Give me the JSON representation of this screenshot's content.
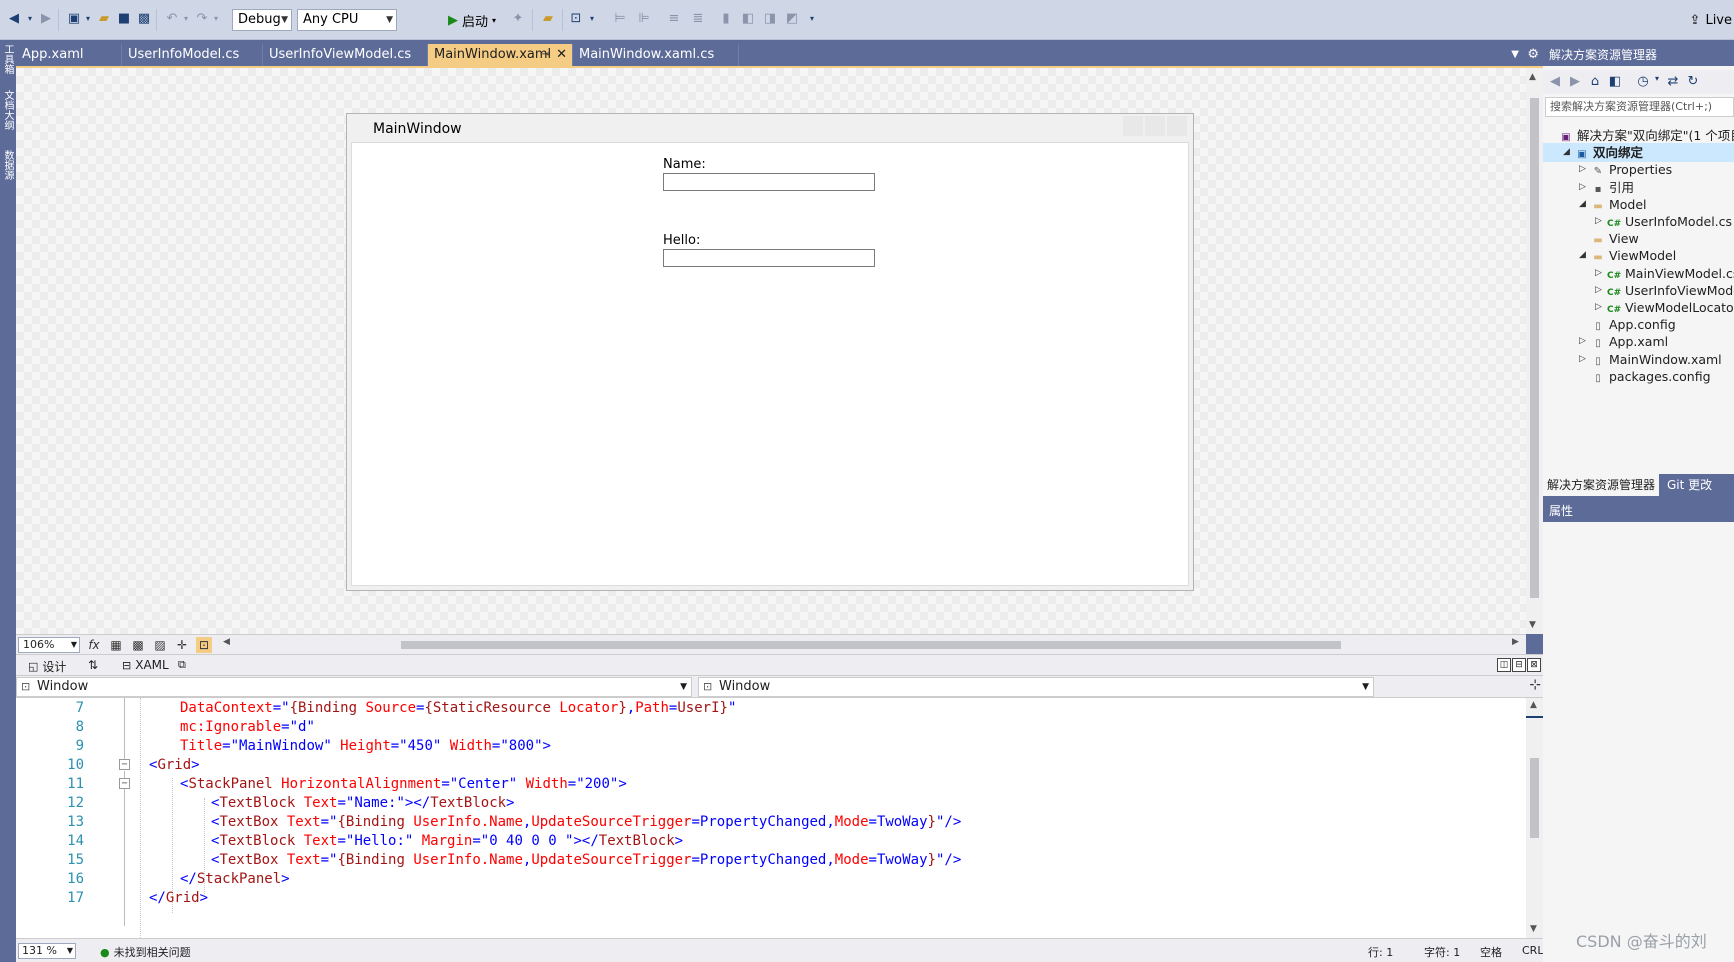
{
  "toolbar": {
    "config_combo": "Debug",
    "platform_combo": "Any CPU",
    "start_label": "启动",
    "live_share_label": "Live"
  },
  "left_rail": {
    "items": [
      "工具箱",
      "文档大纲",
      "数据源"
    ]
  },
  "doc_tabs": [
    {
      "label": "App.xaml",
      "active": false
    },
    {
      "label": "UserInfoModel.cs",
      "active": false
    },
    {
      "label": "UserInfoViewModel.cs",
      "active": false
    },
    {
      "label": "MainWindow.xaml",
      "active": true
    },
    {
      "label": "MainWindow.xaml.cs",
      "active": false
    }
  ],
  "designer": {
    "window_title": "MainWindow",
    "name_label": "Name:",
    "hello_label": "Hello:",
    "zoom": "106%",
    "formula_icon": "fx"
  },
  "split_bar": {
    "design_tab": "设计",
    "swap_icon": "⇅",
    "xaml_tab": "XAML"
  },
  "nav": {
    "left_element": "Window",
    "right_element": "Window"
  },
  "code": {
    "lines": [
      {
        "num": "7",
        "tokens": [
          {
            "t": "DataContext",
            "c": "x-attr"
          },
          {
            "t": "=\"",
            "c": "x-punc"
          },
          {
            "t": "{Binding ",
            "c": "x-tag"
          },
          {
            "t": "Source",
            "c": "x-attr"
          },
          {
            "t": "=",
            "c": "x-punc"
          },
          {
            "t": "{StaticResource ",
            "c": "x-tag"
          },
          {
            "t": "Locator",
            "c": "x-attr"
          },
          {
            "t": "}",
            "c": "x-tag"
          },
          {
            "t": ",",
            "c": "x-punc"
          },
          {
            "t": "Path",
            "c": "x-attr"
          },
          {
            "t": "=",
            "c": "x-punc"
          },
          {
            "t": "UserI}",
            "c": "x-tag"
          },
          {
            "t": "\"",
            "c": "x-punc"
          }
        ]
      },
      {
        "num": "8",
        "tokens": [
          {
            "t": "mc:Ignorable",
            "c": "x-attr"
          },
          {
            "t": "=\"",
            "c": "x-punc"
          },
          {
            "t": "d",
            "c": "x-val"
          },
          {
            "t": "\"",
            "c": "x-punc"
          }
        ]
      },
      {
        "num": "9",
        "tokens": [
          {
            "t": "Title",
            "c": "x-attr"
          },
          {
            "t": "=\"",
            "c": "x-punc"
          },
          {
            "t": "MainWindow",
            "c": "x-val"
          },
          {
            "t": "\" ",
            "c": "x-punc"
          },
          {
            "t": "Height",
            "c": "x-attr"
          },
          {
            "t": "=\"",
            "c": "x-punc"
          },
          {
            "t": "450",
            "c": "x-val"
          },
          {
            "t": "\" ",
            "c": "x-punc"
          },
          {
            "t": "Width",
            "c": "x-attr"
          },
          {
            "t": "=\"",
            "c": "x-punc"
          },
          {
            "t": "800",
            "c": "x-val"
          },
          {
            "t": "\">",
            "c": "x-punc"
          }
        ]
      },
      {
        "num": "10",
        "tokens": [
          {
            "t": "<",
            "c": "x-punc"
          },
          {
            "t": "Grid",
            "c": "x-tag"
          },
          {
            "t": ">",
            "c": "x-punc"
          }
        ]
      },
      {
        "num": "11",
        "tokens": [
          {
            "t": "<",
            "c": "x-punc"
          },
          {
            "t": "StackPanel ",
            "c": "x-tag"
          },
          {
            "t": "HorizontalAlignment",
            "c": "x-attr"
          },
          {
            "t": "=\"",
            "c": "x-punc"
          },
          {
            "t": "Center",
            "c": "x-val"
          },
          {
            "t": "\" ",
            "c": "x-punc"
          },
          {
            "t": "Width",
            "c": "x-attr"
          },
          {
            "t": "=\"",
            "c": "x-punc"
          },
          {
            "t": "200",
            "c": "x-val"
          },
          {
            "t": "\">",
            "c": "x-punc"
          }
        ]
      },
      {
        "num": "12",
        "tokens": [
          {
            "t": "<",
            "c": "x-punc"
          },
          {
            "t": "TextBlock ",
            "c": "x-tag"
          },
          {
            "t": "Text",
            "c": "x-attr"
          },
          {
            "t": "=\"",
            "c": "x-punc"
          },
          {
            "t": "Name:",
            "c": "x-val"
          },
          {
            "t": "\"></",
            "c": "x-punc"
          },
          {
            "t": "TextBlock",
            "c": "x-tag"
          },
          {
            "t": ">",
            "c": "x-punc"
          }
        ]
      },
      {
        "num": "13",
        "tokens": [
          {
            "t": "<",
            "c": "x-punc"
          },
          {
            "t": "TextBox ",
            "c": "x-tag"
          },
          {
            "t": "Text",
            "c": "x-attr"
          },
          {
            "t": "=\"",
            "c": "x-punc"
          },
          {
            "t": "{Binding ",
            "c": "x-tag"
          },
          {
            "t": "UserInfo.Name",
            "c": "x-attr"
          },
          {
            "t": ",",
            "c": "x-punc"
          },
          {
            "t": "UpdateSourceTrigger",
            "c": "x-attr"
          },
          {
            "t": "=",
            "c": "x-punc"
          },
          {
            "t": "PropertyChanged",
            "c": "x-val"
          },
          {
            "t": ",",
            "c": "x-punc"
          },
          {
            "t": "Mode",
            "c": "x-attr"
          },
          {
            "t": "=",
            "c": "x-punc"
          },
          {
            "t": "TwoWay",
            "c": "x-val"
          },
          {
            "t": "}",
            "c": "x-tag"
          },
          {
            "t": "\"/>",
            "c": "x-punc"
          }
        ]
      },
      {
        "num": "14",
        "tokens": [
          {
            "t": "<",
            "c": "x-punc"
          },
          {
            "t": "TextBlock ",
            "c": "x-tag"
          },
          {
            "t": "Text",
            "c": "x-attr"
          },
          {
            "t": "=\"",
            "c": "x-punc"
          },
          {
            "t": "Hello:",
            "c": "x-val"
          },
          {
            "t": "\" ",
            "c": "x-punc"
          },
          {
            "t": "Margin",
            "c": "x-attr"
          },
          {
            "t": "=\"",
            "c": "x-punc"
          },
          {
            "t": "0 40 0 0 ",
            "c": "x-val"
          },
          {
            "t": "\"></",
            "c": "x-punc"
          },
          {
            "t": "TextBlock",
            "c": "x-tag"
          },
          {
            "t": ">",
            "c": "x-punc"
          }
        ]
      },
      {
        "num": "15",
        "tokens": [
          {
            "t": "<",
            "c": "x-punc"
          },
          {
            "t": "TextBox ",
            "c": "x-tag"
          },
          {
            "t": "Text",
            "c": "x-attr"
          },
          {
            "t": "=\"",
            "c": "x-punc"
          },
          {
            "t": "{Binding ",
            "c": "x-tag"
          },
          {
            "t": "UserInfo.Name",
            "c": "x-attr"
          },
          {
            "t": ",",
            "c": "x-punc"
          },
          {
            "t": "UpdateSourceTrigger",
            "c": "x-attr"
          },
          {
            "t": "=",
            "c": "x-punc"
          },
          {
            "t": "PropertyChanged",
            "c": "x-val"
          },
          {
            "t": ",",
            "c": "x-punc"
          },
          {
            "t": "Mode",
            "c": "x-attr"
          },
          {
            "t": "=",
            "c": "x-punc"
          },
          {
            "t": "TwoWay",
            "c": "x-val"
          },
          {
            "t": "}",
            "c": "x-tag"
          },
          {
            "t": "\"/>",
            "c": "x-punc"
          }
        ]
      },
      {
        "num": "16",
        "tokens": [
          {
            "t": "</",
            "c": "x-punc"
          },
          {
            "t": "StackPanel",
            "c": "x-tag"
          },
          {
            "t": ">",
            "c": "x-punc"
          }
        ]
      },
      {
        "num": "17",
        "tokens": [
          {
            "t": "</",
            "c": "x-punc"
          },
          {
            "t": "Grid",
            "c": "x-tag"
          },
          {
            "t": ">",
            "c": "x-punc"
          }
        ]
      }
    ]
  },
  "status": {
    "zoom": "131 %",
    "issues": "未找到相关问题",
    "line": "行: 1",
    "char": "字符: 1",
    "space": "空格",
    "eol": "CRLF"
  },
  "solution_explorer": {
    "title": "解决方案资源管理器",
    "search_placeholder": "搜索解决方案资源管理器(Ctrl+;)",
    "tree": [
      {
        "label": "解决方案\"双向绑定\"(1 个项目",
        "icon": "sln",
        "arrow": ""
      },
      {
        "label": "双向绑定",
        "icon": "proj",
        "arrow": "◢"
      },
      {
        "label": "Properties",
        "icon": "wrench",
        "arrow": "▷"
      },
      {
        "label": "引用",
        "icon": "ref",
        "arrow": "▷"
      },
      {
        "label": "Model",
        "icon": "folder",
        "arrow": "◢"
      },
      {
        "label": "UserInfoModel.cs",
        "icon": "cs",
        "arrow": "▷"
      },
      {
        "label": "View",
        "icon": "folder",
        "arrow": ""
      },
      {
        "label": "ViewModel",
        "icon": "folder",
        "arrow": "◢"
      },
      {
        "label": "MainViewModel.cs",
        "icon": "cs",
        "arrow": "▷"
      },
      {
        "label": "UserInfoViewModel.cs",
        "icon": "cs",
        "arrow": "▷"
      },
      {
        "label": "ViewModelLocator.cs",
        "icon": "cs",
        "arrow": "▷"
      },
      {
        "label": "App.config",
        "icon": "file",
        "arrow": ""
      },
      {
        "label": "App.xaml",
        "icon": "file",
        "arrow": "▷"
      },
      {
        "label": "MainWindow.xaml",
        "icon": "file",
        "arrow": "▷"
      },
      {
        "label": "packages.config",
        "icon": "file",
        "arrow": ""
      }
    ],
    "tabs": [
      "解决方案资源管理器",
      "Git 更改"
    ]
  },
  "properties": {
    "title": "属性"
  },
  "watermark": "CSDN @奋斗的刘"
}
